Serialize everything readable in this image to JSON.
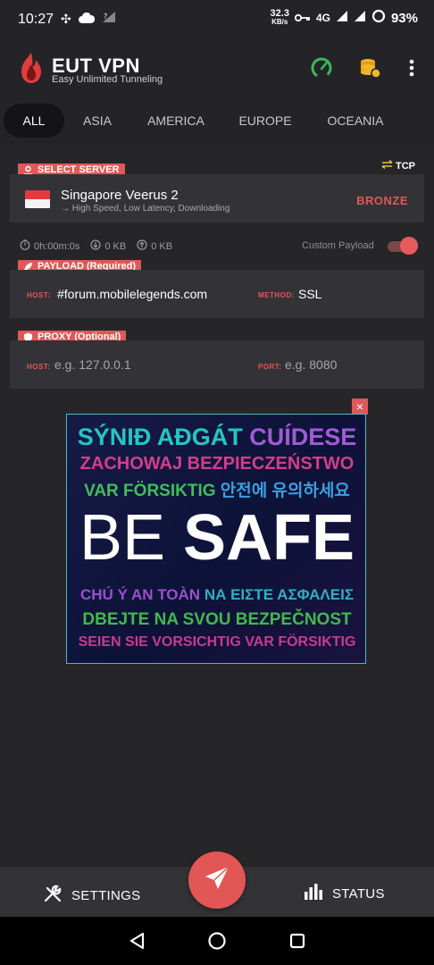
{
  "status_bar": {
    "time": "10:27",
    "net_speed": "32.3",
    "net_unit": "KB/s",
    "network": "4G",
    "battery": "93%"
  },
  "header": {
    "title": "EUT VPN",
    "subtitle": "Easy Unlimited Tunneling",
    "icons": [
      "speedometer-icon",
      "coins-icon",
      "more-vert-icon"
    ]
  },
  "tabs": [
    {
      "label": "ALL",
      "active": true
    },
    {
      "label": "ASIA",
      "active": false
    },
    {
      "label": "AMERICA",
      "active": false
    },
    {
      "label": "EUROPE",
      "active": false
    },
    {
      "label": "OCEANIA",
      "active": false
    }
  ],
  "server": {
    "section_label": "SELECT SERVER",
    "protocol": "TCP",
    "name": "Singapore Veerus 2",
    "description": "→ High Speed, Low Latency, Downloading",
    "tier": "BRONZE"
  },
  "stats": {
    "duration": "0h:00m:0s",
    "download": "0 KB",
    "upload": "0 KB",
    "custom_payload_label": "Custom Payload",
    "custom_payload_enabled": true
  },
  "payload": {
    "section_label": "PAYLOAD (Required)",
    "host_label": "HOST:",
    "host_value": "#forum.mobilelegends.com",
    "method_label": "METHOD:",
    "method_value": "SSL"
  },
  "proxy": {
    "section_label": "PROXY (Optional)",
    "host_label": "HOST:",
    "host_placeholder": "e.g. 127.0.0.1",
    "port_label": "PORT:",
    "port_placeholder": "e.g. 8080"
  },
  "ad": {
    "close": "×",
    "lines": [
      {
        "a": "SÝNIÐ AÐGÁT",
        "b": "CUÍDESE"
      },
      {
        "a": "ZACHOWAJ BEZPIECZEŃSTWO"
      },
      {
        "a": "VAR FÖRSIKTIG",
        "b": "안전에 유의하세요"
      },
      {
        "a": "BE",
        "b": "SAFE"
      },
      {
        "a": "CHÚ Ý AN TOÀN",
        "b": "ΝΑ ΕΙΣΤΕ ΑΣΦΑΛΕΙΣ"
      },
      {
        "a": "DBEJTE NA SVOU BEZPEČNOST"
      },
      {
        "a": "SEIEN SIE VORSICHTIG",
        "b": "VAR FÖRSIKTIG"
      }
    ]
  },
  "bottom_bar": {
    "settings_label": "SETTINGS",
    "status_label": "STATUS"
  },
  "colors": {
    "accent": "#e05858",
    "background": "#262629",
    "card": "#333337",
    "bar": "#242428"
  }
}
